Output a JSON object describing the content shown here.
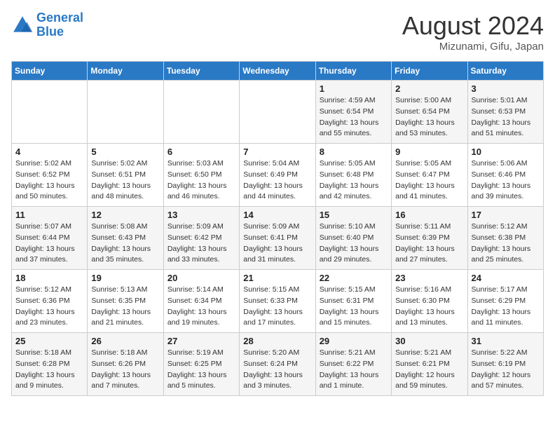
{
  "logo": {
    "line1": "General",
    "line2": "Blue"
  },
  "title": "August 2024",
  "subtitle": "Mizunami, Gifu, Japan",
  "days_of_week": [
    "Sunday",
    "Monday",
    "Tuesday",
    "Wednesday",
    "Thursday",
    "Friday",
    "Saturday"
  ],
  "weeks": [
    [
      {
        "day": "",
        "info": ""
      },
      {
        "day": "",
        "info": ""
      },
      {
        "day": "",
        "info": ""
      },
      {
        "day": "",
        "info": ""
      },
      {
        "day": "1",
        "info": "Sunrise: 4:59 AM\nSunset: 6:54 PM\nDaylight: 13 hours\nand 55 minutes."
      },
      {
        "day": "2",
        "info": "Sunrise: 5:00 AM\nSunset: 6:54 PM\nDaylight: 13 hours\nand 53 minutes."
      },
      {
        "day": "3",
        "info": "Sunrise: 5:01 AM\nSunset: 6:53 PM\nDaylight: 13 hours\nand 51 minutes."
      }
    ],
    [
      {
        "day": "4",
        "info": "Sunrise: 5:02 AM\nSunset: 6:52 PM\nDaylight: 13 hours\nand 50 minutes."
      },
      {
        "day": "5",
        "info": "Sunrise: 5:02 AM\nSunset: 6:51 PM\nDaylight: 13 hours\nand 48 minutes."
      },
      {
        "day": "6",
        "info": "Sunrise: 5:03 AM\nSunset: 6:50 PM\nDaylight: 13 hours\nand 46 minutes."
      },
      {
        "day": "7",
        "info": "Sunrise: 5:04 AM\nSunset: 6:49 PM\nDaylight: 13 hours\nand 44 minutes."
      },
      {
        "day": "8",
        "info": "Sunrise: 5:05 AM\nSunset: 6:48 PM\nDaylight: 13 hours\nand 42 minutes."
      },
      {
        "day": "9",
        "info": "Sunrise: 5:05 AM\nSunset: 6:47 PM\nDaylight: 13 hours\nand 41 minutes."
      },
      {
        "day": "10",
        "info": "Sunrise: 5:06 AM\nSunset: 6:46 PM\nDaylight: 13 hours\nand 39 minutes."
      }
    ],
    [
      {
        "day": "11",
        "info": "Sunrise: 5:07 AM\nSunset: 6:44 PM\nDaylight: 13 hours\nand 37 minutes."
      },
      {
        "day": "12",
        "info": "Sunrise: 5:08 AM\nSunset: 6:43 PM\nDaylight: 13 hours\nand 35 minutes."
      },
      {
        "day": "13",
        "info": "Sunrise: 5:09 AM\nSunset: 6:42 PM\nDaylight: 13 hours\nand 33 minutes."
      },
      {
        "day": "14",
        "info": "Sunrise: 5:09 AM\nSunset: 6:41 PM\nDaylight: 13 hours\nand 31 minutes."
      },
      {
        "day": "15",
        "info": "Sunrise: 5:10 AM\nSunset: 6:40 PM\nDaylight: 13 hours\nand 29 minutes."
      },
      {
        "day": "16",
        "info": "Sunrise: 5:11 AM\nSunset: 6:39 PM\nDaylight: 13 hours\nand 27 minutes."
      },
      {
        "day": "17",
        "info": "Sunrise: 5:12 AM\nSunset: 6:38 PM\nDaylight: 13 hours\nand 25 minutes."
      }
    ],
    [
      {
        "day": "18",
        "info": "Sunrise: 5:12 AM\nSunset: 6:36 PM\nDaylight: 13 hours\nand 23 minutes."
      },
      {
        "day": "19",
        "info": "Sunrise: 5:13 AM\nSunset: 6:35 PM\nDaylight: 13 hours\nand 21 minutes."
      },
      {
        "day": "20",
        "info": "Sunrise: 5:14 AM\nSunset: 6:34 PM\nDaylight: 13 hours\nand 19 minutes."
      },
      {
        "day": "21",
        "info": "Sunrise: 5:15 AM\nSunset: 6:33 PM\nDaylight: 13 hours\nand 17 minutes."
      },
      {
        "day": "22",
        "info": "Sunrise: 5:15 AM\nSunset: 6:31 PM\nDaylight: 13 hours\nand 15 minutes."
      },
      {
        "day": "23",
        "info": "Sunrise: 5:16 AM\nSunset: 6:30 PM\nDaylight: 13 hours\nand 13 minutes."
      },
      {
        "day": "24",
        "info": "Sunrise: 5:17 AM\nSunset: 6:29 PM\nDaylight: 13 hours\nand 11 minutes."
      }
    ],
    [
      {
        "day": "25",
        "info": "Sunrise: 5:18 AM\nSunset: 6:28 PM\nDaylight: 13 hours\nand 9 minutes."
      },
      {
        "day": "26",
        "info": "Sunrise: 5:18 AM\nSunset: 6:26 PM\nDaylight: 13 hours\nand 7 minutes."
      },
      {
        "day": "27",
        "info": "Sunrise: 5:19 AM\nSunset: 6:25 PM\nDaylight: 13 hours\nand 5 minutes."
      },
      {
        "day": "28",
        "info": "Sunrise: 5:20 AM\nSunset: 6:24 PM\nDaylight: 13 hours\nand 3 minutes."
      },
      {
        "day": "29",
        "info": "Sunrise: 5:21 AM\nSunset: 6:22 PM\nDaylight: 13 hours\nand 1 minute."
      },
      {
        "day": "30",
        "info": "Sunrise: 5:21 AM\nSunset: 6:21 PM\nDaylight: 12 hours\nand 59 minutes."
      },
      {
        "day": "31",
        "info": "Sunrise: 5:22 AM\nSunset: 6:19 PM\nDaylight: 12 hours\nand 57 minutes."
      }
    ]
  ]
}
